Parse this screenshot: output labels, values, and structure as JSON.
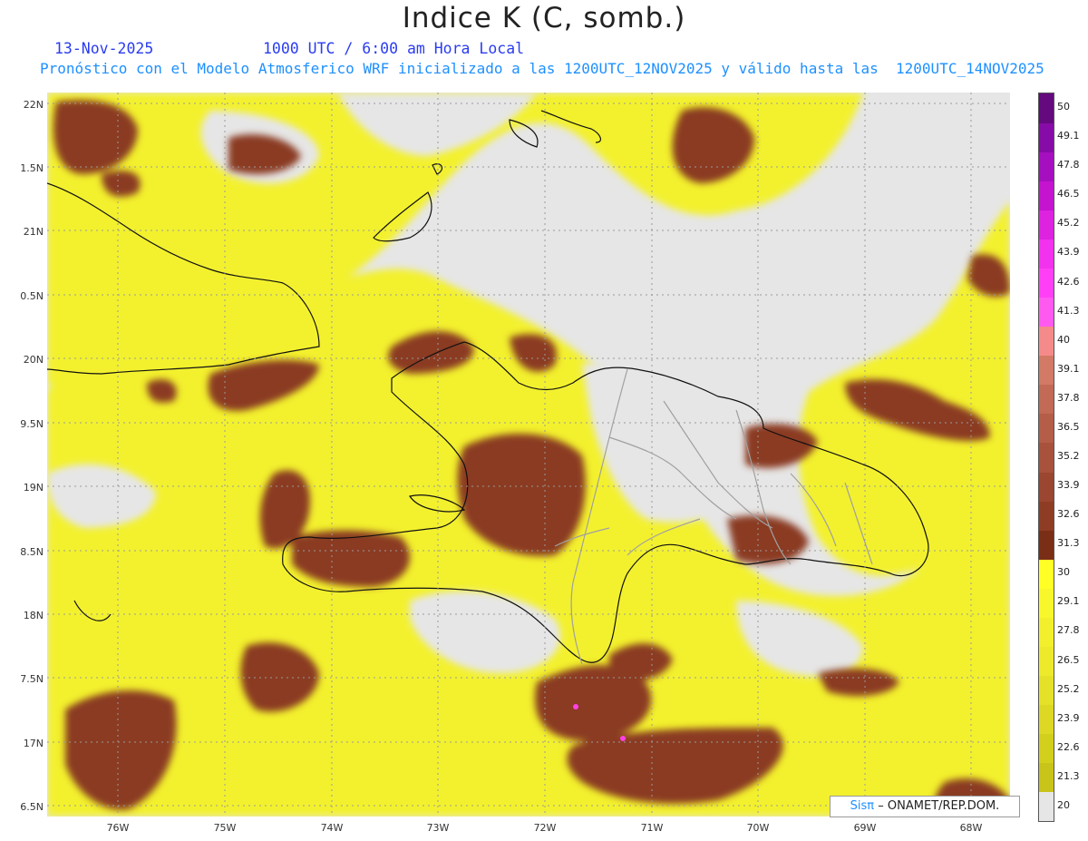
{
  "header": {
    "title": "Indice K (C, somb.)",
    "date": "13-Nov-2025",
    "time": "1000 UTC / 6:00 am Hora Local",
    "forecast": "Pronóstico con el Modelo Atmosferico WRF inicializado a las 1200UTC_12NOV2025 y válido hasta las  1200UTC_14NOV2025"
  },
  "axes": {
    "lat_labels": [
      "22N",
      "1.5N",
      "21N",
      "0.5N",
      "20N",
      "9.5N",
      "19N",
      "8.5N",
      "18N",
      "7.5N",
      "17N",
      "6.5N"
    ],
    "lon_labels": [
      "76W",
      "75W",
      "74W",
      "73W",
      "72W",
      "71W",
      "70W",
      "69W",
      "68W"
    ]
  },
  "legend": {
    "values": [
      "20",
      "21.3",
      "22.6",
      "23.9",
      "25.2",
      "26.5",
      "27.8",
      "29.1",
      "30",
      "31.3",
      "32.6",
      "33.9",
      "35.2",
      "36.5",
      "37.8",
      "39.1",
      "40",
      "41.3",
      "42.6",
      "43.9",
      "45.2",
      "46.5",
      "47.8",
      "49.1",
      "50"
    ],
    "colors": [
      "#e6e6e6",
      "#c9c41a",
      "#d3cf1d",
      "#dcd823",
      "#e4e128",
      "#ecea2b",
      "#f2f02c",
      "#f8f72b",
      "#ffff26",
      "#7b2e16",
      "#8e3d24",
      "#9a4630",
      "#a8523b",
      "#b45d47",
      "#c26a55",
      "#d27a66",
      "#f58a8a",
      "#ff5af0",
      "#ff3ff5",
      "#f232ee",
      "#dd22e0",
      "#c514d0",
      "#a60fbf",
      "#870ba6",
      "#65097f"
    ]
  },
  "credit": {
    "brand": "Sisπ",
    "rest": "– ONAMET/REP.DOM."
  }
}
